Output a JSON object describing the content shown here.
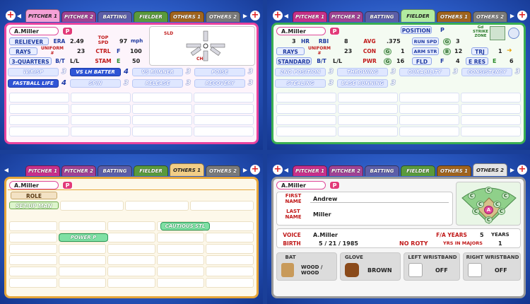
{
  "tabs": {
    "pitcher1": "PITCHER 1",
    "pitcher2": "PITCHER 2",
    "batting": "BATTING",
    "fielder": "FIELDER",
    "others1": "OTHERS 1",
    "others2": "OTHERS 2"
  },
  "player": {
    "name": "A.Miller",
    "pos_badge": "P"
  },
  "pitcher": {
    "role": "RELIEVER",
    "era_label": "ERA",
    "era": "2.49",
    "topspd_label": "TOP SPD",
    "topspd": "97",
    "topspd_unit": "mph",
    "team": "RAYS",
    "uniform_label": "UNIFORM #",
    "uniform": "23",
    "ctrl_label": "CTRL",
    "ctrl_grade": "F",
    "ctrl": "100",
    "delivery": "3-QUARTERS",
    "bt_label": "B/T",
    "bt": "L/L",
    "stam_label": "STAM",
    "stam_grade": "E",
    "stam": "50",
    "diagram": {
      "top_label": "SLD",
      "bottom_label": "CHG"
    },
    "abilities": [
      {
        "label": "W/RISP",
        "level": "3",
        "hl": false
      },
      {
        "label": "VS LH BATTER",
        "level": "4",
        "hl": true
      },
      {
        "label": "VS RUNNER",
        "level": "3",
        "hl": false
      },
      {
        "label": "POISE",
        "level": "3",
        "hl": false
      },
      {
        "label": "FASTBALL LIFE",
        "level": "4",
        "hl": true
      },
      {
        "label": "SPIN",
        "level": "3",
        "hl": false
      },
      {
        "label": "RELEASE",
        "level": "3",
        "hl": false
      },
      {
        "label": "RECOVERY",
        "level": "3",
        "hl": false
      }
    ]
  },
  "fielder": {
    "pos_label": "POSITION",
    "pos": "P",
    "gd_label": "Gd STRIKE ZONE",
    "avg_label": "AVG",
    "avg": ".375",
    "hr": "3",
    "hr_label": "HR",
    "rbi_label": "RBI",
    "rbi": "8",
    "runspd_label": "RUN SPD",
    "runspd_grade": "G",
    "runspd": "3",
    "team": "RAYS",
    "uniform_label": "UNIFORM #",
    "uniform": "23",
    "con_label": "CON",
    "con_grade": "G",
    "con": "1",
    "armstr_label": "ARM STR",
    "armstr_grade": "B",
    "armstr": "12",
    "trj_label": "TRJ",
    "trj": "1",
    "stance": "STANDARD",
    "bt_label": "B/T",
    "bt": "L/L",
    "pwr_label": "PWR",
    "pwr_grade": "G",
    "pwr": "16",
    "fld_label": "FLD",
    "fld_grade": "F",
    "fld": "4",
    "eres_label": "E RES",
    "eres_grade": "E",
    "eres": "6",
    "abilities": [
      {
        "label": "2ND POSITION",
        "level": "3"
      },
      {
        "label": "THROWING",
        "level": "3"
      },
      {
        "label": "DURABILITY",
        "level": "3"
      },
      {
        "label": "CONSISTENCY",
        "level": "3"
      },
      {
        "label": "STEALING",
        "level": "3"
      },
      {
        "label": "BASE RUNNING",
        "level": "3"
      }
    ]
  },
  "others1": {
    "role_label": "ROLE",
    "role": "SET-UP MAN",
    "specials": [
      "CAUTIOUS STL",
      "POWER P"
    ]
  },
  "others2": {
    "first_label": "FIRST NAME",
    "first": "Andrew",
    "last_label": "LAST NAME",
    "last": "Miller",
    "voice_label": "VOICE",
    "voice": "A.Miller",
    "fa_label": "F/A YEARS",
    "fa": "5",
    "fa_unit": "YEARS",
    "birth_label": "BIRTH",
    "birth": "5 / 21 / 1985",
    "roty": "NO ROTY",
    "yrs_label": "YRS IN MAJORS",
    "yrs": "1",
    "bat_label": "BAT",
    "bat": "WOOD / WOOD",
    "glove_label": "GLOVE",
    "glove": "BROWN",
    "lwb_label": "LEFT WRISTBAND",
    "lwb": "OFF",
    "rwb_label": "RIGHT WRISTBAND",
    "rwb": "OFF",
    "field_pos": [
      "C",
      "C",
      "C",
      "C",
      "C",
      "C",
      "C",
      "C"
    ],
    "field_main": "A"
  }
}
